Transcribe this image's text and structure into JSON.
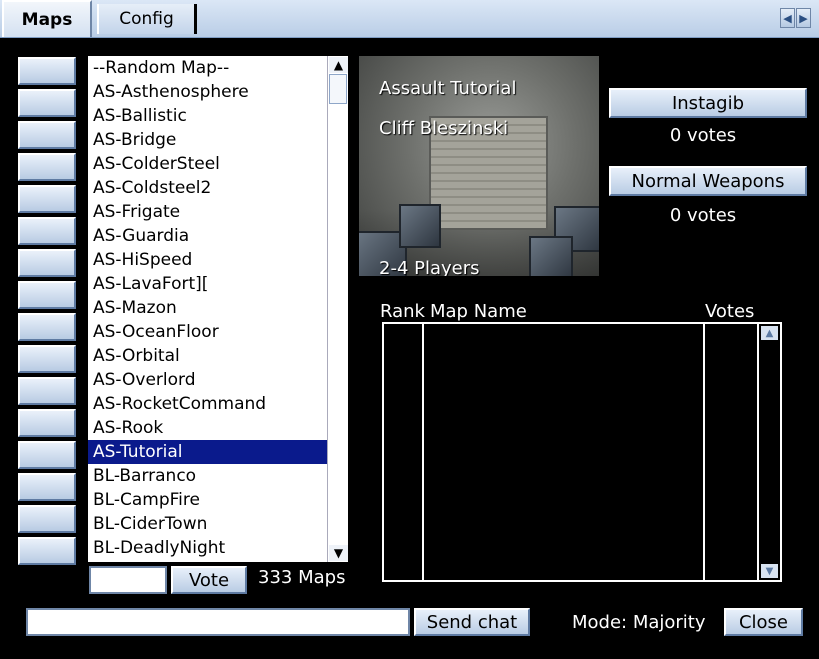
{
  "tabs": [
    {
      "label": "Maps",
      "active": true
    },
    {
      "label": "Config",
      "active": false
    }
  ],
  "tab_scroll": {
    "left_icon": "arrow-left-icon",
    "right_icon": "arrow-right-icon"
  },
  "map_list": {
    "items": [
      "--Random Map--",
      "AS-Asthenosphere",
      "AS-Ballistic",
      "AS-Bridge",
      "AS-ColderSteel",
      "AS-Coldsteel2",
      "AS-Frigate",
      "AS-Guardia",
      "AS-HiSpeed",
      "AS-LavaFort][",
      "AS-Mazon",
      "AS-OceanFloor",
      "AS-Orbital",
      "AS-Overlord",
      "AS-RocketCommand",
      "AS-Rook",
      "AS-Tutorial",
      "BL-Barranco",
      "BL-CampFire",
      "BL-CiderTown",
      "BL-DeadlyNight"
    ],
    "selected": "AS-Tutorial"
  },
  "vote": {
    "input_value": "",
    "button_label": "Vote",
    "map_count": "333 Maps"
  },
  "preview": {
    "title": "Assault Tutorial",
    "author": "Cliff Bleszinski",
    "players": "2-4 Players"
  },
  "gametypes": [
    {
      "label": "Instagib",
      "votes": "0 votes"
    },
    {
      "label": "Normal Weapons",
      "votes": "0 votes"
    }
  ],
  "rank_table": {
    "headers": [
      "Rank",
      "Map Name",
      "Votes"
    ],
    "rows": []
  },
  "chat": {
    "input_value": "",
    "send_label": "Send chat"
  },
  "mode": "Mode: Majority",
  "close_label": "Close",
  "colors": {
    "accent": "#0a1a8c",
    "button_top": "#e8f0fa",
    "button_bottom": "#b9cce4"
  }
}
